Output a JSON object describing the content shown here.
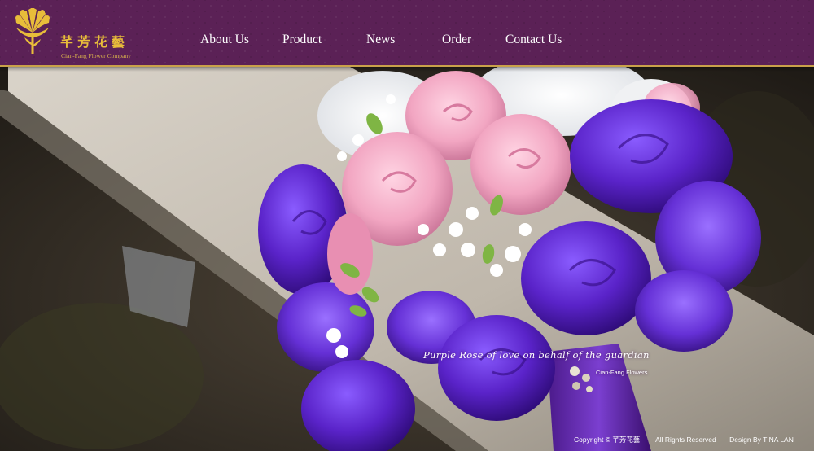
{
  "header": {
    "logo": {
      "title": "芊芳花藝",
      "subtitle": "Cian-Fang Flower Company",
      "icon": "flower-crest-icon"
    },
    "nav": {
      "items": [
        {
          "label": "About Us"
        },
        {
          "label": "Product"
        },
        {
          "label": "News"
        },
        {
          "label": "Order"
        },
        {
          "label": "Contact Us"
        }
      ]
    }
  },
  "hero": {
    "caption": "Purple Rose of love on behalf of the guardian",
    "caption_sub": "Cian-Fang Flowers"
  },
  "footer": {
    "copyright": "Copyright  ©  芊芳花藝.",
    "rights": "All Rights Reserved",
    "design": "Design By TINA LAN"
  },
  "colors": {
    "header_bg": "#5b2156",
    "accent_gold": "#c9a14a",
    "logo_gold": "#e8bd3a",
    "nav_text": "#ffffff"
  }
}
